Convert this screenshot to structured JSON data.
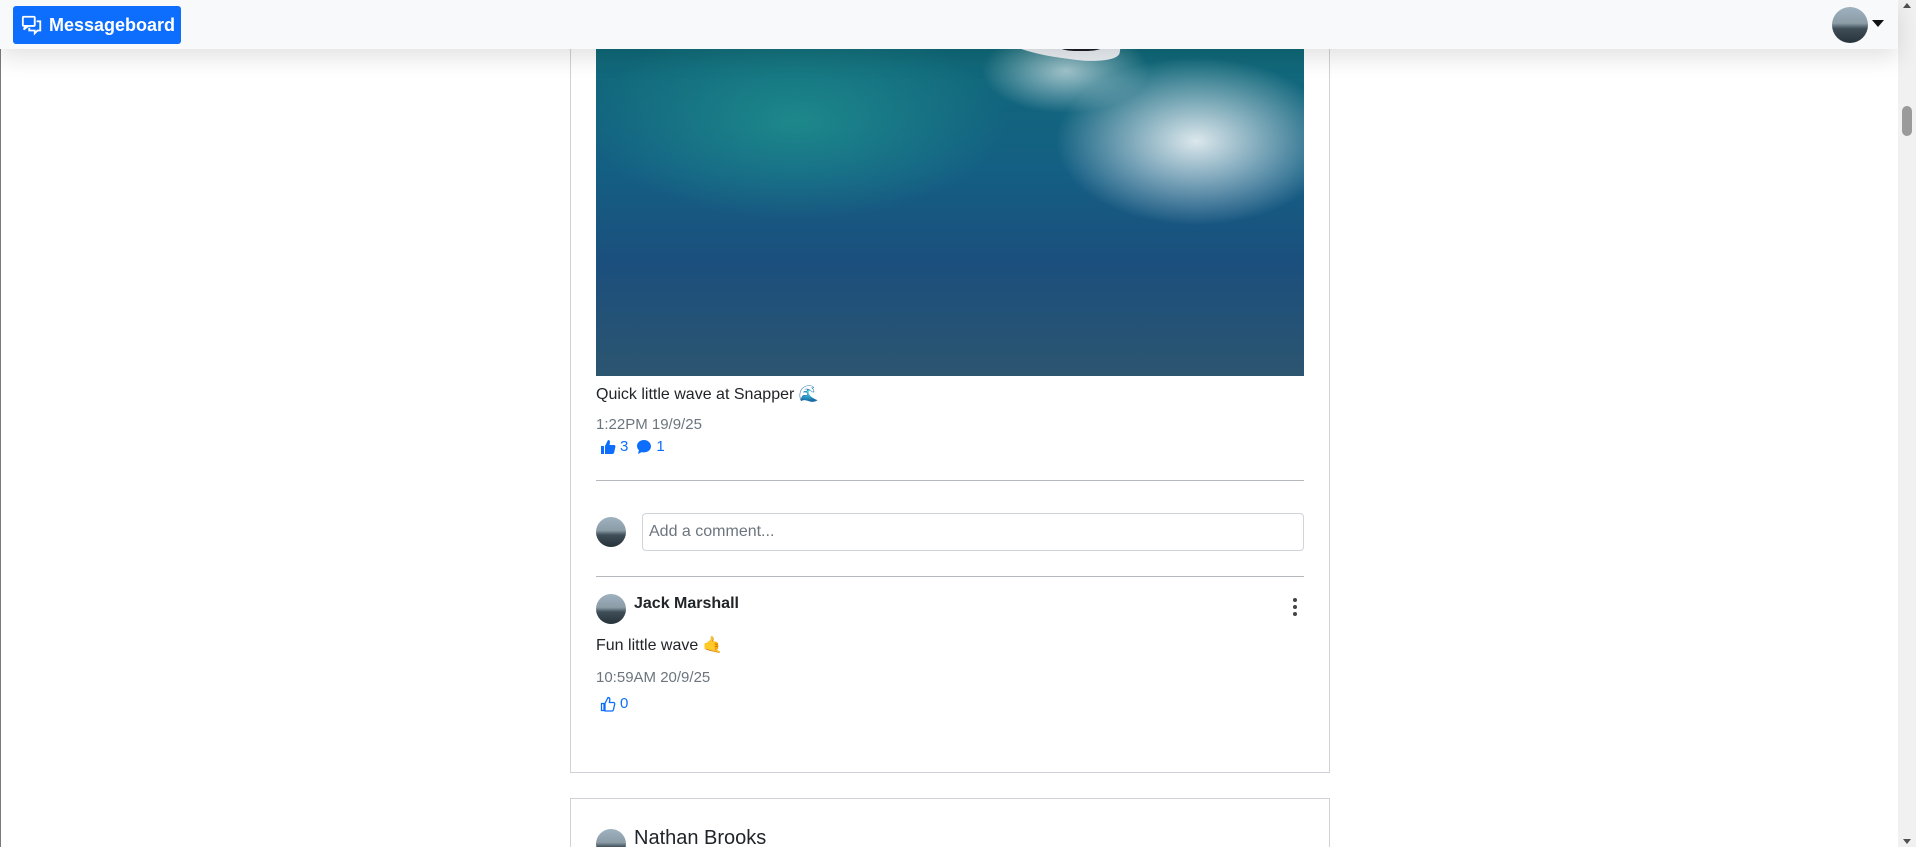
{
  "navbar": {
    "brand_label": "Messageboard",
    "brand_color": "#0d6efd",
    "brand_icon": "chat-bubbles-icon",
    "user_menu_icon": "caret-down-icon"
  },
  "post": {
    "image_alt": "surfer-on-wave-photo",
    "caption": "Quick little wave at Snapper 🌊",
    "timestamp": "1:22PM 19/9/25",
    "likes": "3",
    "comments": "1",
    "comment_input_placeholder": "Add a comment..."
  },
  "comments": [
    {
      "author": "Jack Marshall",
      "text": "Fun little wave 🤙",
      "timestamp": "10:59AM 20/9/25",
      "likes": "0"
    }
  ],
  "next_post": {
    "author": "Nathan Brooks"
  },
  "colors": {
    "accent": "#0d6efd",
    "muted": "#6c757d",
    "navbar_bg": "#f8f9fa"
  }
}
